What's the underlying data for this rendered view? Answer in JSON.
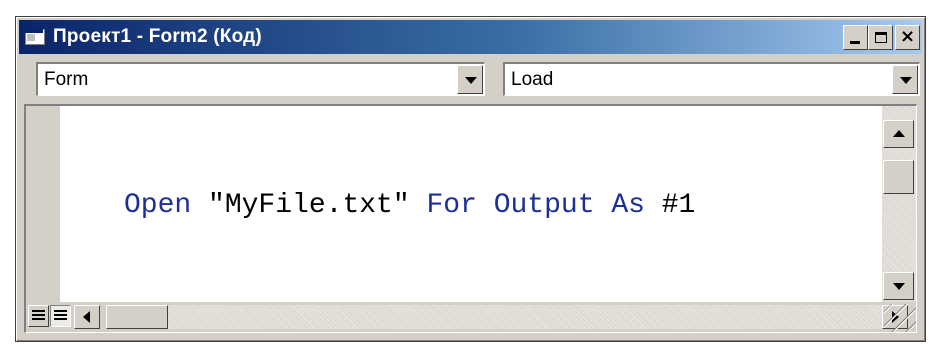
{
  "window": {
    "title": "Проект1 - Form2 (Код)",
    "controls": [
      "minimize",
      "maximize",
      "close"
    ],
    "close_glyph": "×"
  },
  "combos": {
    "object": {
      "value": "Form"
    },
    "procedure": {
      "value": "Load"
    }
  },
  "code": {
    "tokens": [
      {
        "text": "Open",
        "kind": "keyword"
      },
      {
        "text": " \"MyFile.txt\" ",
        "kind": "text"
      },
      {
        "text": "For",
        "kind": "keyword"
      },
      {
        "text": " ",
        "kind": "text"
      },
      {
        "text": "Output",
        "kind": "keyword"
      },
      {
        "text": " ",
        "kind": "text"
      },
      {
        "text": "As",
        "kind": "keyword"
      },
      {
        "text": " #1",
        "kind": "text"
      }
    ]
  },
  "colors": {
    "keyword": "#1c2f96",
    "text": "#000000",
    "titlebar_start": "#0a246a",
    "titlebar_end": "#a6caf0",
    "chrome": "#d4d0c8"
  },
  "icons": {
    "title": "vb-code-window-icon",
    "procedure_view": "procedure-view-icon",
    "full_module_view": "full-module-view-icon"
  }
}
